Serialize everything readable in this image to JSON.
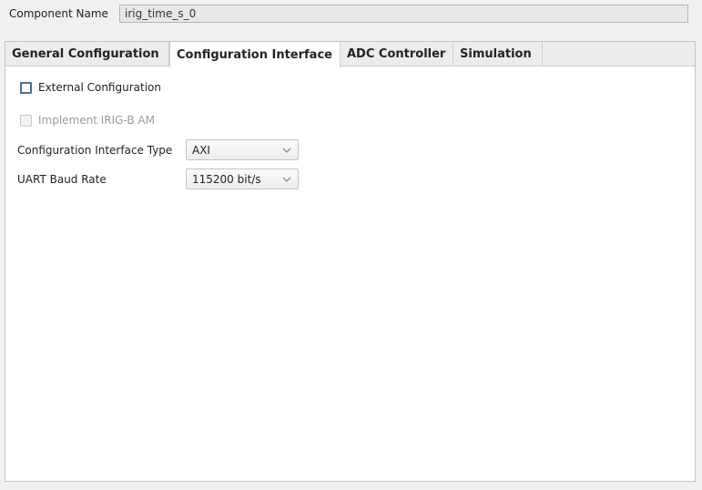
{
  "component": {
    "label": "Component Name",
    "value": "irig_time_s_0"
  },
  "tabs": [
    {
      "label": "General Configuration",
      "active": false
    },
    {
      "label": "Configuration Interface",
      "active": true
    },
    {
      "label": "ADC Controller",
      "active": false
    },
    {
      "label": "Simulation",
      "active": false
    }
  ],
  "options": {
    "external_config": {
      "label": "External Configuration",
      "checked": false,
      "enabled": true
    },
    "irig_b_am": {
      "label": "Implement IRIG-B AM",
      "checked": false,
      "enabled": false
    }
  },
  "fields": {
    "interface_type": {
      "label": "Configuration Interface Type",
      "value": "AXI"
    },
    "baud_rate": {
      "label": "UART Baud Rate",
      "value": "115200 bit/s"
    }
  },
  "colors": {
    "checkbox_border": "#4d6f96",
    "disabled_text": "#9a9a9a",
    "panel_bg": "#ffffff",
    "window_bg": "#f0f0f0"
  }
}
